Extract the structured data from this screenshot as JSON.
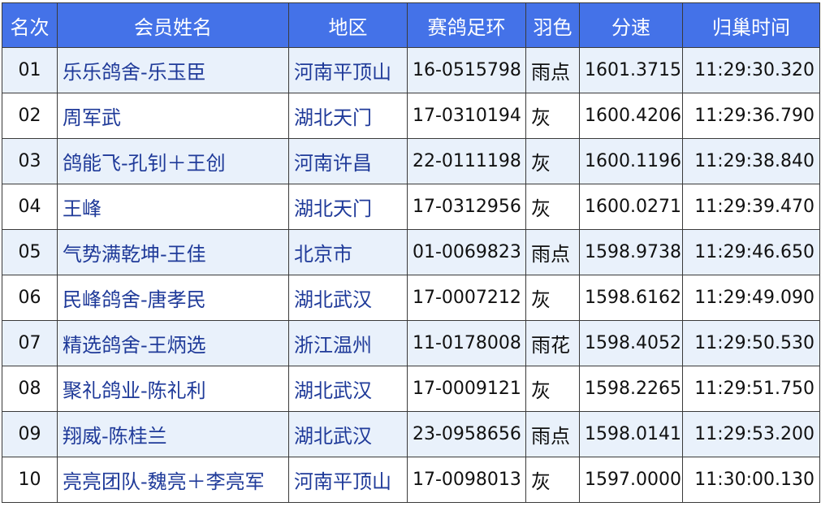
{
  "table": {
    "headers": [
      "名次",
      "会员姓名",
      "地区",
      "赛鸽足环",
      "羽色",
      "分速",
      "归巢时间"
    ],
    "rows": [
      [
        "01",
        "乐乐鸽舍-乐玉臣",
        "河南平顶山",
        "16-0515798",
        "雨点",
        "1601.3715",
        "11:29:30.320"
      ],
      [
        "02",
        "周军武",
        "湖北天门",
        "17-0310194",
        "灰",
        "1600.4206",
        "11:29:36.790"
      ],
      [
        "03",
        "鸽能飞-孔钊＋王创",
        "河南许昌",
        "22-0111198",
        "灰",
        "1600.1196",
        "11:29:38.840"
      ],
      [
        "04",
        "王峰",
        "湖北天门",
        "17-0312956",
        "灰",
        "1600.0271",
        "11:29:39.470"
      ],
      [
        "05",
        "气势满乾坤-王佳",
        "北京市",
        "01-0069823",
        "雨点",
        "1598.9738",
        "11:29:46.650"
      ],
      [
        "06",
        "民峰鸽舍-唐孝民",
        "湖北武汉",
        "17-0007212",
        "灰",
        "1598.6162",
        "11:29:49.090"
      ],
      [
        "07",
        "精选鸽舍-王炳选",
        "浙江温州",
        "11-0178008",
        "雨花",
        "1598.4052",
        "11:29:50.530"
      ],
      [
        "08",
        "聚礼鸽业-陈礼利",
        "湖北武汉",
        "17-0009121",
        "灰",
        "1598.2265",
        "11:29:51.750"
      ],
      [
        "09",
        "翔威-陈桂兰",
        "湖北武汉",
        "23-0958656",
        "雨点",
        "1598.0141",
        "11:29:53.200"
      ],
      [
        "10",
        "亮亮团队-魏亮＋李亮军",
        "河南平顶山",
        "17-0098013",
        "灰",
        "1597.0000",
        "11:30:00.130"
      ]
    ]
  },
  "colors": {
    "header_bg": "#4472e8",
    "header_text": "#ffffff",
    "row_alt_bg": "#e9f1fb",
    "link_text": "#1f3a99"
  }
}
